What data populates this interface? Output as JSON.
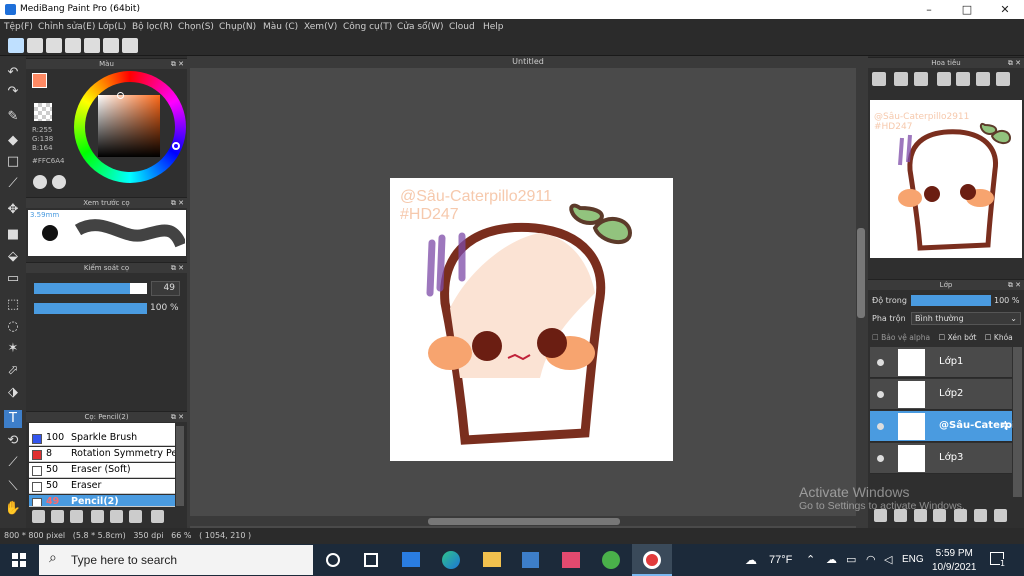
{
  "window": {
    "title": "MediBang Paint Pro (64bit)",
    "minimize": "–",
    "maximize": "□",
    "close": "✕"
  },
  "menu": [
    "Tệp(F)",
    "Chỉnh sửa(E)",
    "Lớp(L)",
    "Bộ lọc(R)",
    "Chọn(S)",
    "Chụp(N)",
    "Màu (C)",
    "Xem(V)",
    "Công cụ(T)",
    "Cửa sổ(W)",
    "Cloud",
    "Help"
  ],
  "color_panel": {
    "title": "Màu",
    "r": "R:255",
    "g": "G:138",
    "b": "B:164",
    "hex": "#FFC6A4",
    "fg_color": "#FF8A64",
    "bg_color": "#FFFFFF"
  },
  "brush_preview": {
    "title": "Xem trước cọ",
    "size": "3.59mm"
  },
  "brush_control": {
    "title": "Kiểm soát cọ",
    "size_value": "49",
    "size_fraction": 0.85,
    "opacity_value": "100 %",
    "opacity_fraction": 1.0
  },
  "brush_list": {
    "title": "Cọ: Pencil(2)",
    "items": [
      {
        "size": "100",
        "name": "Sparkle Brush",
        "color": "#3355ee"
      },
      {
        "size": "8",
        "name": "Rotation Symmetry Pen",
        "color": "#e03030"
      },
      {
        "size": "50",
        "name": "Eraser (Soft)",
        "color": "#ffffff"
      },
      {
        "size": "50",
        "name": "Eraser",
        "color": "#ffffff"
      },
      {
        "size": "49",
        "name": "Pencil(2)",
        "color": "#ffffff"
      }
    ]
  },
  "document": {
    "tab": "Untitled",
    "watermark_line1": "@Sâu-Caterpillo2911",
    "watermark_line2": "#HD247"
  },
  "navigator": {
    "title": "Hoa tiêu",
    "watermark_line1": "@Sâu-Caterpillo2911",
    "watermark_line2": "#HD247"
  },
  "layer_panel": {
    "title": "Lớp",
    "opacity_label": "Độ trong",
    "opacity_value": "100 %",
    "blend_label": "Pha trộn",
    "blend_value": "Bình thường",
    "protect_alpha": "Bảo vệ alpha",
    "clipping": "Xén bớt",
    "lock": "Khóa",
    "layers": [
      {
        "name": "Lớp1",
        "selected": false
      },
      {
        "name": "Lớp2",
        "selected": false
      },
      {
        "name": "@Sâu-Caterpil",
        "selected": true
      },
      {
        "name": "Lớp3",
        "selected": false
      }
    ]
  },
  "status": {
    "text": "800 * 800 pixel   (5.8 * 5.8cm)   350 dpi   66 %   ( 1054, 210 )"
  },
  "activate": {
    "line1": "Activate Windows",
    "line2": "Go to Settings to activate Windows."
  },
  "taskbar": {
    "search_placeholder": "Type here to search",
    "weather": "77°F",
    "lang": "ENG",
    "time": "5:59 PM",
    "date": "10/9/2021",
    "notif_count": "1"
  }
}
